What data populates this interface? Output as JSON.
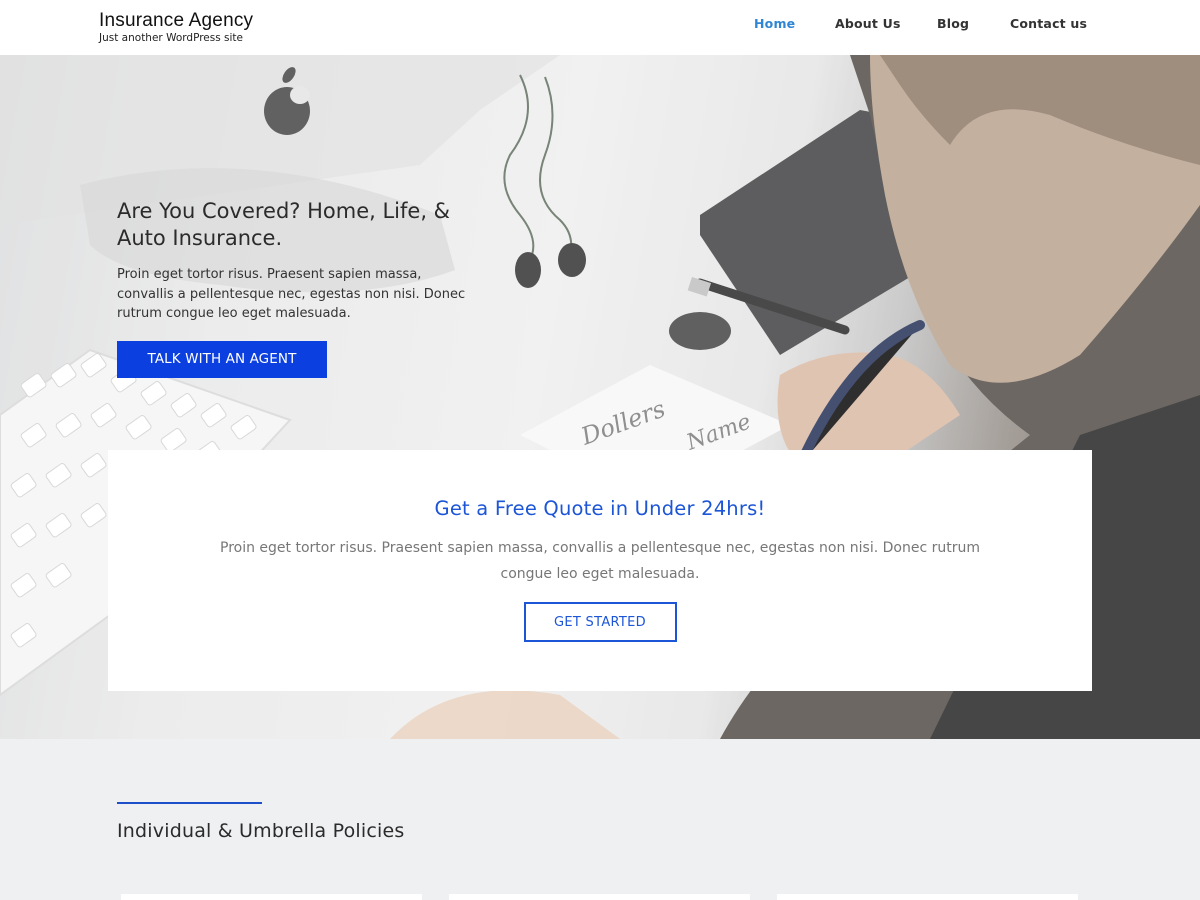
{
  "header": {
    "site_title": "Insurance Agency",
    "tagline": "Just another WordPress site",
    "nav": [
      {
        "label": "Home",
        "active": true
      },
      {
        "label": "About Us",
        "active": false
      },
      {
        "label": "Blog",
        "active": false
      },
      {
        "label": "Contact us",
        "active": false
      }
    ]
  },
  "hero": {
    "title": "Are You Covered? Home, Life, & Auto Insurance.",
    "text": "Proin eget tortor risus. Praesent sapien massa, convallis a pellentesque nec, egestas non nisi. Donec rutrum congue leo eget malesuada.",
    "button_label": "TALK WITH AN AGENT",
    "note_handwriting": [
      "Dollers",
      "Name"
    ]
  },
  "quote": {
    "title": "Get a Free Quote in Under 24hrs!",
    "text": "Proin eget tortor risus. Praesent sapien massa, convallis a pellentesque nec, egestas non nisi. Donec rutrum congue leo eget malesuada.",
    "button_label": "GET STARTED"
  },
  "policies": {
    "title": "Individual & Umbrella Policies"
  },
  "colors": {
    "accent_blue": "#1c55d6",
    "button_blue": "#0b3fe0",
    "nav_active": "#2f86d4",
    "section_bg": "#eff0f2"
  }
}
